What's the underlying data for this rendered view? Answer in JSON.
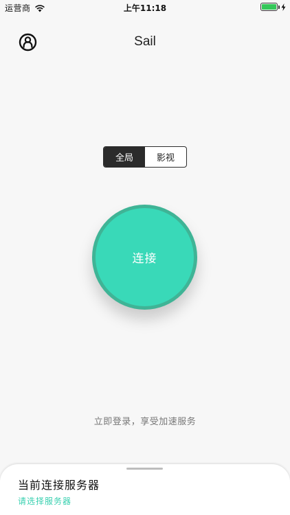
{
  "status_bar": {
    "carrier": "运营商",
    "time": "上午11:18",
    "battery_level": 1.0,
    "icons": [
      "wifi-icon",
      "battery-icon",
      "charging-bolt-icon"
    ]
  },
  "nav": {
    "title": "Sail",
    "left_icon": "user-circle-icon"
  },
  "mode_selector": {
    "options": [
      "全局",
      "影视"
    ],
    "selected": "全局"
  },
  "connect": {
    "label": "连接"
  },
  "login_hint": "立即登录，享受加速服务",
  "server_sheet": {
    "title": "当前连接服务器",
    "subtitle": "请选择服务器"
  },
  "colors": {
    "accent": "#39d9b8",
    "accent_ring": "#3fb496",
    "segment_active": "#2b2b2b",
    "link": "#39d0b0"
  }
}
